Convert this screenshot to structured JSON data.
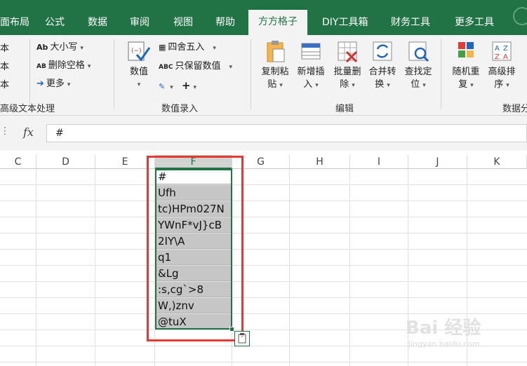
{
  "tabs": {
    "partial_layout": "面布局",
    "formulas": "公式",
    "data": "数据",
    "review": "审阅",
    "view": "视图",
    "help": "帮助",
    "fangfang": "方方格子",
    "diy": "DIY工具箱",
    "finance": "财务工具",
    "more": "更多工具"
  },
  "ribbon": {
    "text_group": {
      "label": "高级文本处理",
      "left_items": [
        "本",
        "本",
        "本"
      ],
      "case": "大小写",
      "case_icon": "Ab",
      "remove_spaces": "删除空格",
      "remove_spaces_icon": "AB",
      "more": "更多"
    },
    "number_group": {
      "label": "数值录入",
      "value_button": "数值",
      "round": "四舍五入",
      "keep_value": "只保留数值",
      "keep_value_icon": "ABC"
    },
    "edit_group": {
      "label": "编辑",
      "buttons": [
        {
          "top": "复制粘",
          "bottom": "贴"
        },
        {
          "top": "新增插",
          "bottom": "入"
        },
        {
          "top": "批量删",
          "bottom": "除"
        },
        {
          "top": "合并转",
          "bottom": "换"
        },
        {
          "top": "查找定",
          "bottom": "位"
        }
      ]
    },
    "data_group": {
      "label": "数据分",
      "buttons": [
        {
          "top": "随机重",
          "bottom": "复"
        },
        {
          "top": "高级排",
          "bottom": "序"
        }
      ]
    }
  },
  "formula_bar": {
    "fx": "fx",
    "value": "#"
  },
  "columns": [
    "C",
    "D",
    "E",
    "F",
    "G",
    "H",
    "I",
    "J",
    "K"
  ],
  "selected_column": "F",
  "cells": [
    "#",
    "Ufh",
    "tc)HPm027N",
    "YWnF*vJ}cB",
    "2IY\\A",
    "q1",
    "&Lg",
    ":s,cg`>8",
    "W,)znv",
    "@tuX"
  ],
  "watermark": {
    "brand": "Bai 经验",
    "url": "jingyan.baidu.com"
  },
  "colors": {
    "excel_green": "#217346",
    "selection_gray": "#c6c6c6",
    "highlight_red": "#e53935"
  }
}
